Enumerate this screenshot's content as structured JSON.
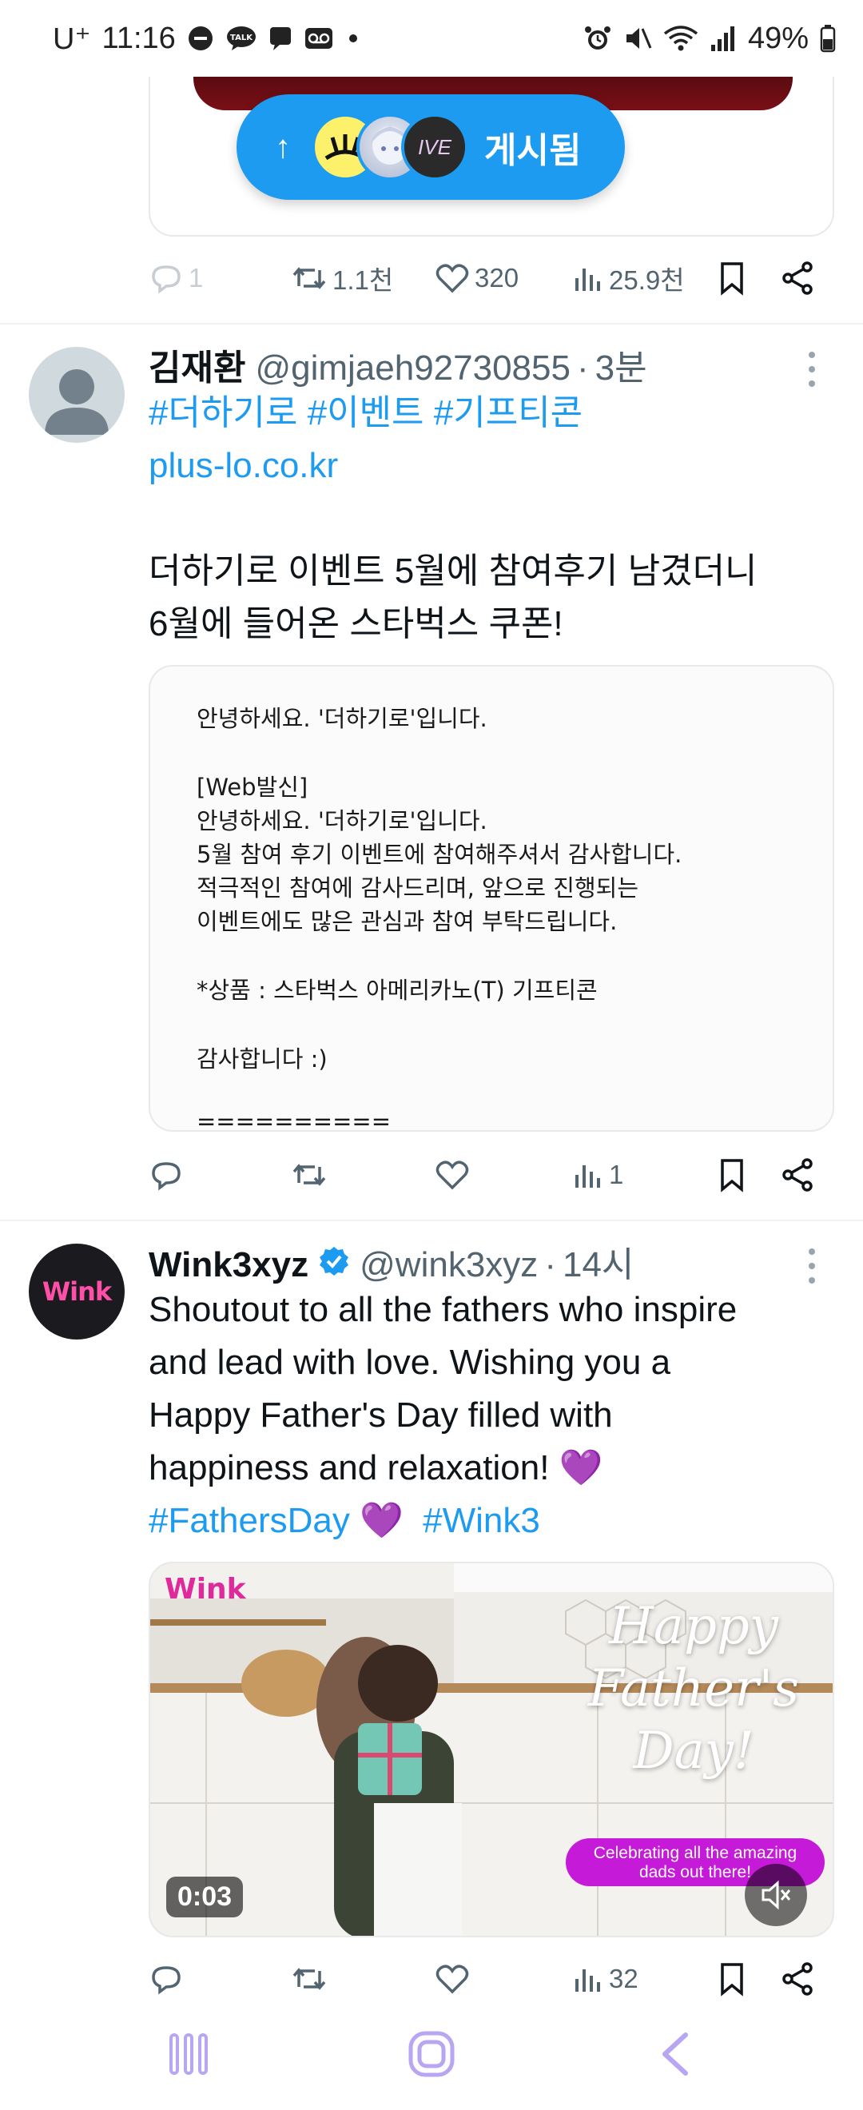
{
  "status_bar": {
    "carrier": "U⁺",
    "time": "11:16",
    "battery": "49%",
    "icons_left": [
      "minus-circle-icon",
      "talk-icon",
      "chat-bubble-icon",
      "voicemail-icon",
      "dot-icon"
    ],
    "icons_right": [
      "alarm-icon",
      "mute-icon",
      "wifi-icon",
      "signal-icon",
      "battery-icon"
    ]
  },
  "posted_pill": {
    "label": "게시됨",
    "avatar_3_text": "IVE"
  },
  "post1_actions": {
    "replies": "1",
    "retweets": "1.1천",
    "likes": "320",
    "views": "25.9천"
  },
  "tweet2": {
    "name": "김재환",
    "handle": "@gimjaeh92730855",
    "dot": "·",
    "time": "3분",
    "hashtags": "#더하기로 #이벤트 #기프티콘",
    "link": "plus-lo.co.kr",
    "body_line1": "더하기로 이벤트 5월에 참여후기 남겼더니",
    "body_line2": "6월에 들어온 스타벅스 쿠폰!",
    "note_lines": [
      "안녕하세요. '더하기로'입니다.",
      "[Web발신]",
      "안녕하세요. '더하기로'입니다.",
      "5월 참여 후기 이벤트에 참여해주셔서 감사합니다.",
      "적극적인 참여에 감사드리며, 앞으로 진행되는",
      "이벤트에도 많은 관심과 참여 부탁드립니다.",
      "*상품 : 스타벅스 아메리카노(T) 기프티콘",
      "감사합니다 :)",
      "=========="
    ],
    "actions": {
      "views": "1"
    }
  },
  "tweet3": {
    "name": "Wink3xyz",
    "handle": "@wink3xyz",
    "dot": "·",
    "time": "14시",
    "avatar_text": "Wink",
    "body_line1": "Shoutout to all the fathers who inspire",
    "body_line2": "and lead with love. Wishing you a",
    "body_line3": "Happy Father's Day filled with",
    "body_line4": "happiness and relaxation! 💜",
    "hashtag1": "#FathersDay",
    "hashtag_heart": "💜",
    "hashtag2": "#Wink3",
    "video": {
      "logo": "Wink",
      "script_line1": "Happy",
      "script_line2": "Father's",
      "script_line3": "Day!",
      "banner_line1": "Celebrating all the amazing",
      "banner_line2": "dads out there!",
      "duration": "0:03"
    },
    "actions": {
      "views": "32"
    }
  },
  "nav": {
    "icons": [
      "recent-apps-icon",
      "home-icon",
      "back-icon"
    ]
  },
  "colors": {
    "accent": "#1d9bf0",
    "text": "#0f1419",
    "muted": "#536471",
    "nav": "#b9a6f3",
    "purple_banner": "#c61ad9"
  }
}
